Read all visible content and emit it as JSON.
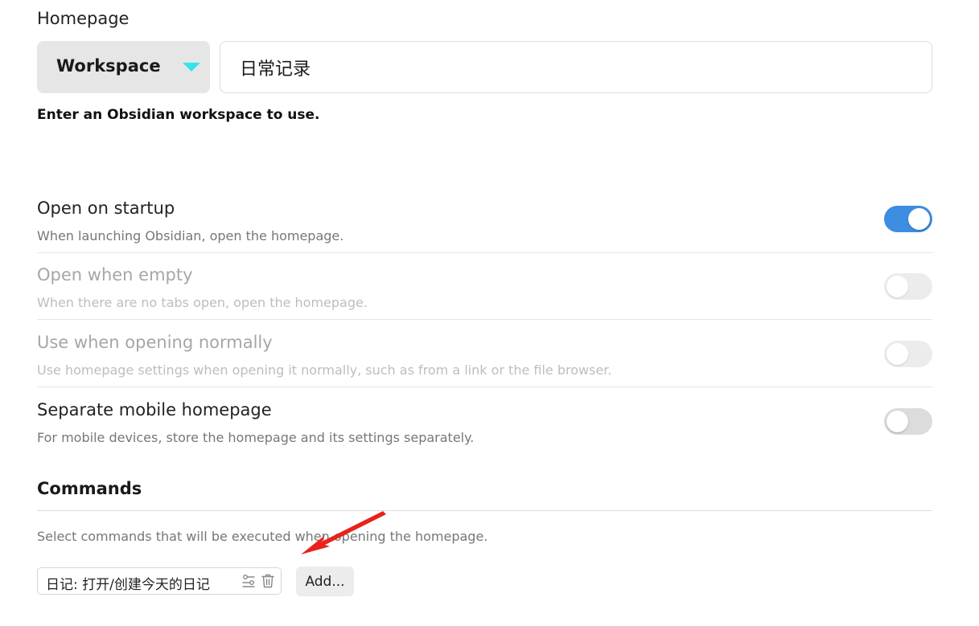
{
  "homepage": {
    "label": "Homepage",
    "type_select": {
      "value": "Workspace"
    },
    "workspace_input": {
      "value": "日常记录"
    },
    "helper": "Enter an Obsidian workspace to use."
  },
  "settings": [
    {
      "title": "Open on startup",
      "description": "When launching Obsidian, open the homepage.",
      "enabled": true,
      "disabled": false
    },
    {
      "title": "Open when empty",
      "description": "When there are no tabs open, open the homepage.",
      "enabled": false,
      "disabled": true
    },
    {
      "title": "Use when opening normally",
      "description": "Use homepage settings when opening it normally, such as from a link or the file browser.",
      "enabled": false,
      "disabled": true
    },
    {
      "title": "Separate mobile homepage",
      "description": "For mobile devices, store the homepage and its settings separately.",
      "enabled": false,
      "disabled": false
    }
  ],
  "commands": {
    "heading": "Commands",
    "description": "Select commands that will be executed when opening the homepage.",
    "items": [
      {
        "label": "日记: 打开/创建今天的日记",
        "icons": [
          "settings-sliders-icon",
          "trash-icon"
        ]
      }
    ],
    "add_label": "Add..."
  },
  "colors": {
    "toggle_on": "#3d8de0",
    "caret": "#36e3ef",
    "annotation_arrow": "#e8221c"
  }
}
